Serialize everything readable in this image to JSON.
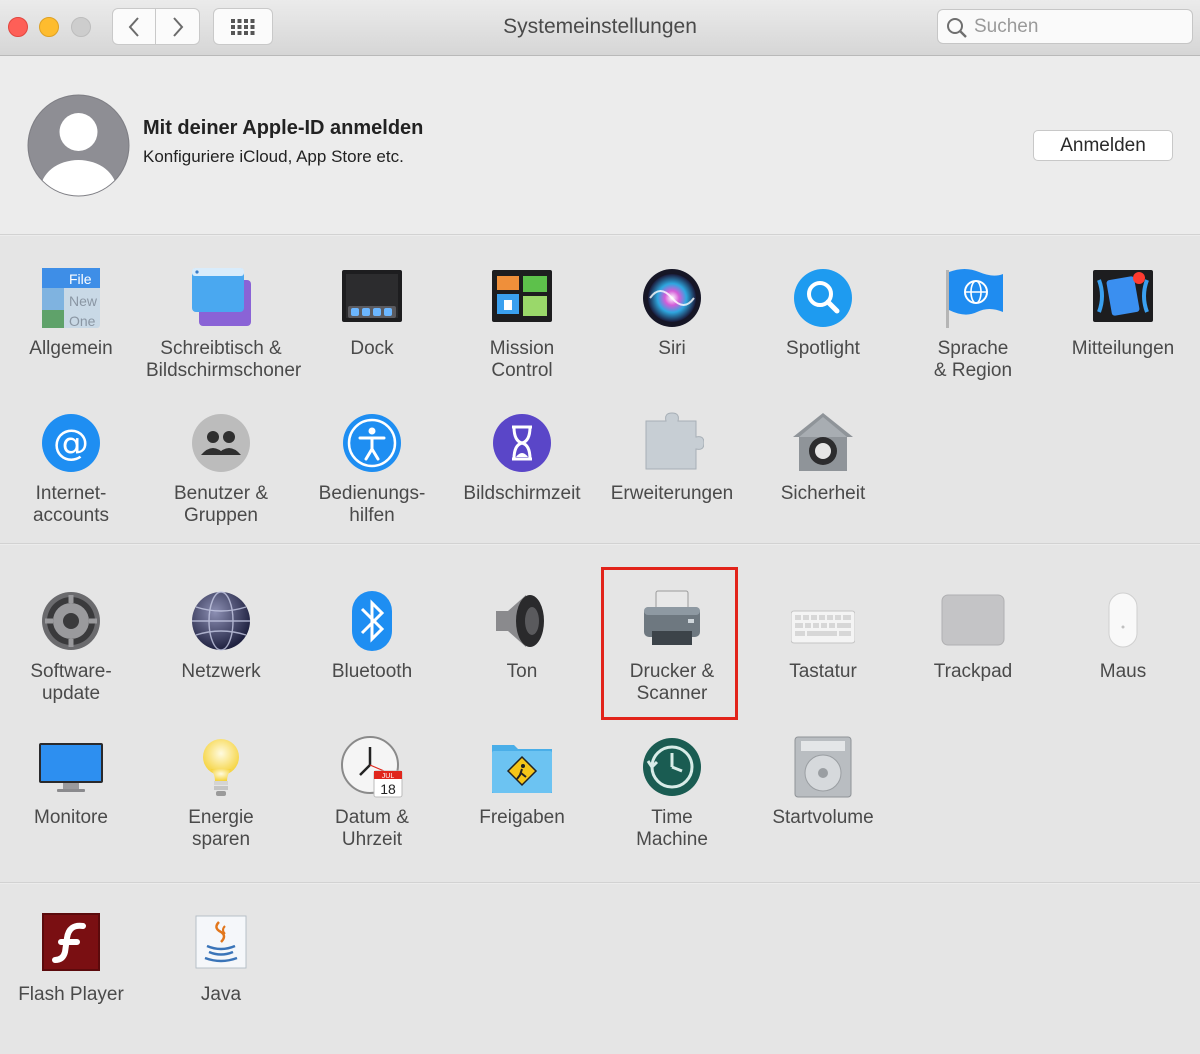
{
  "window": {
    "title": "Systemeinstellungen",
    "search_placeholder": "Suchen"
  },
  "apple_id": {
    "title": "Mit deiner Apple-ID anmelden",
    "subtitle": "Konfiguriere iCloud, App Store etc.",
    "signin_label": "Anmelden"
  },
  "section1": [
    {
      "label": "Allgemein",
      "icon": "general-icon"
    },
    {
      "label": "Schreibtisch &\nBildschirmschoner",
      "icon": "desktop-screensaver-icon"
    },
    {
      "label": "Dock",
      "icon": "dock-icon"
    },
    {
      "label": "Mission\nControl",
      "icon": "mission-control-icon"
    },
    {
      "label": "Siri",
      "icon": "siri-icon"
    },
    {
      "label": "Spotlight",
      "icon": "spotlight-icon"
    },
    {
      "label": "Sprache\n& Region",
      "icon": "language-region-icon"
    },
    {
      "label": "Mitteilungen",
      "icon": "notifications-icon"
    },
    {
      "label": "Internet-\naccounts",
      "icon": "internet-accounts-icon"
    },
    {
      "label": "Benutzer &\nGruppen",
      "icon": "users-groups-icon"
    },
    {
      "label": "Bedienungs-\nhilfen",
      "icon": "accessibility-icon"
    },
    {
      "label": "Bildschirmzeit",
      "icon": "screen-time-icon"
    },
    {
      "label": "Erweiterungen",
      "icon": "extensions-icon"
    },
    {
      "label": "Sicherheit",
      "icon": "security-icon"
    }
  ],
  "section2": [
    {
      "label": "Software-\nupdate",
      "icon": "software-update-icon"
    },
    {
      "label": "Netzwerk",
      "icon": "network-icon"
    },
    {
      "label": "Bluetooth",
      "icon": "bluetooth-icon"
    },
    {
      "label": "Ton",
      "icon": "sound-icon"
    },
    {
      "label": "Drucker &\nScanner",
      "icon": "printer-scanner-icon"
    },
    {
      "label": "Tastatur",
      "icon": "keyboard-icon"
    },
    {
      "label": "Trackpad",
      "icon": "trackpad-icon"
    },
    {
      "label": "Maus",
      "icon": "mouse-icon"
    },
    {
      "label": "Monitore",
      "icon": "displays-icon"
    },
    {
      "label": "Energie\nsparen",
      "icon": "energy-saver-icon"
    },
    {
      "label": "Datum &\nUhrzeit",
      "icon": "date-time-icon"
    },
    {
      "label": "Freigaben",
      "icon": "sharing-icon"
    },
    {
      "label": "Time\nMachine",
      "icon": "time-machine-icon"
    },
    {
      "label": "Startvolume",
      "icon": "startup-disk-icon"
    }
  ],
  "section3": [
    {
      "label": "Flash Player",
      "icon": "flash-player-icon"
    },
    {
      "label": "Java",
      "icon": "java-icon"
    }
  ],
  "calendar_icon": {
    "month": "JUL",
    "day": "18"
  },
  "general_icon": {
    "line1": "File",
    "line2": "New",
    "line3": "One"
  }
}
